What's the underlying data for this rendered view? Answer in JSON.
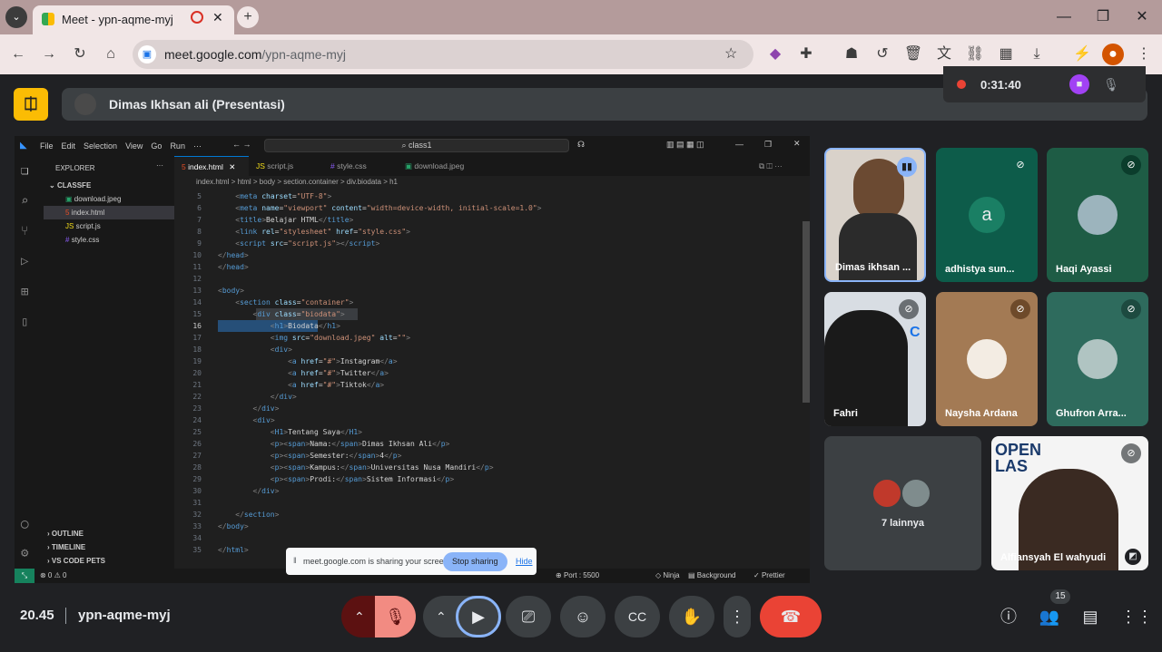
{
  "browser": {
    "tab_title": "Meet - ypn-aqme-myj",
    "url_host": "meet.google.com",
    "url_path": "/ypn-aqme-myj"
  },
  "meet": {
    "presenter_label": "Dimas Ikhsan ali (Presentasi)",
    "recording_time": "0:31:40",
    "clock": "20.45",
    "meeting_code": "ypn-aqme-myj",
    "participants_count": "15",
    "more_label": "7 lainnya",
    "share_notice": "meet.google.com is sharing your screen.",
    "stop_sharing": "Stop sharing",
    "hide": "Hide"
  },
  "participants": [
    {
      "name": "Dimas ikhsan ..."
    },
    {
      "name": "adhistya sun...",
      "initial": "a"
    },
    {
      "name": "Haqi Ayassi"
    },
    {
      "name": "Fahri"
    },
    {
      "name": "Naysha Ardana"
    },
    {
      "name": "Ghufron Arra..."
    },
    {
      "name": "Alfiansyah El wahyudi"
    }
  ],
  "vscode": {
    "menu": [
      "File",
      "Edit",
      "Selection",
      "View",
      "Go",
      "Run",
      "···"
    ],
    "search": "class1",
    "explorer_title": "EXPLORER",
    "folder": "CLASSFE",
    "files": [
      "download.jpeg",
      "index.html",
      "script.js",
      "style.css"
    ],
    "tabs": [
      "index.html",
      "script.js",
      "style.css",
      "download.jpeg"
    ],
    "breadcrumb": "index.html > html > body > section.container > div.biodata > h1",
    "outline": [
      "OUTLINE",
      "TIMELINE",
      "VS CODE PETS"
    ],
    "status_left": "⊗ 0 ⚠ 0",
    "status_right": [
      "Port : 5500",
      "Ninja",
      "Background",
      "Prettier"
    ],
    "code_lines": [
      {
        "n": "5",
        "html": "    <span class='p'>&lt;</span><span class='t'>meta</span> <span class='a'>charset</span>=<span class='s'>\"UTF-8\"</span><span class='p'>&gt;</span>"
      },
      {
        "n": "6",
        "html": "    <span class='p'>&lt;</span><span class='t'>meta</span> <span class='a'>name</span>=<span class='s'>\"viewport\"</span> <span class='a'>content</span>=<span class='s'>\"width=device-width, initial-scale=1.0\"</span><span class='p'>&gt;</span>"
      },
      {
        "n": "7",
        "html": "    <span class='p'>&lt;</span><span class='t'>title</span><span class='p'>&gt;</span>Belajar HTML<span class='p'>&lt;/</span><span class='t'>title</span><span class='p'>&gt;</span>"
      },
      {
        "n": "8",
        "html": "    <span class='p'>&lt;</span><span class='t'>link</span> <span class='a'>rel</span>=<span class='s'>\"stylesheet\"</span> <span class='a'>href</span>=<span class='s'>\"style.css\"</span><span class='p'>&gt;</span>"
      },
      {
        "n": "9",
        "html": "    <span class='p'>&lt;</span><span class='t'>script</span> <span class='a'>src</span>=<span class='s'>\"script.js\"</span><span class='p'>&gt;&lt;/</span><span class='t'>script</span><span class='p'>&gt;</span>"
      },
      {
        "n": "10",
        "html": "<span class='p'>&lt;/</span><span class='t'>head</span><span class='p'>&gt;</span>"
      },
      {
        "n": "11",
        "html": "<span class='p'>&lt;/</span><span class='t'>head</span><span class='p'>&gt;</span>"
      },
      {
        "n": "12",
        "html": ""
      },
      {
        "n": "13",
        "html": "<span class='p'>&lt;</span><span class='t'>body</span><span class='p'>&gt;</span>"
      },
      {
        "n": "14",
        "html": "    <span class='p'>&lt;</span><span class='t'>section</span> <span class='a'>class</span>=<span class='s'>\"container\"</span><span class='p'>&gt;</span>"
      },
      {
        "n": "15",
        "html": "        <span class='p'>&lt;</span><span class='t'>div</span> <span class='a'>class</span>=<span class='s'>\"biodata\"</span><span class='p'>&gt;</span>"
      },
      {
        "n": "16",
        "html": "            <span class='p'>&lt;</span><span class='t'>h1</span><span class='p'>&gt;</span>Biodata<span class='p'>&lt;/</span><span class='t'>h1</span><span class='p'>&gt;</span>"
      },
      {
        "n": "17",
        "html": "            <span class='p'>&lt;</span><span class='t'>img</span> <span class='a'>src</span>=<span class='s'>\"download.jpeg\"</span> <span class='a'>alt</span>=<span class='s'>\"\"</span><span class='p'>&gt;</span>"
      },
      {
        "n": "18",
        "html": "            <span class='p'>&lt;</span><span class='t'>div</span><span class='p'>&gt;</span>"
      },
      {
        "n": "19",
        "html": "                <span class='p'>&lt;</span><span class='t'>a</span> <span class='a'>href</span>=<span class='s'>\"#\"</span><span class='p'>&gt;</span>Instagram<span class='p'>&lt;/</span><span class='t'>a</span><span class='p'>&gt;</span>"
      },
      {
        "n": "20",
        "html": "                <span class='p'>&lt;</span><span class='t'>a</span> <span class='a'>href</span>=<span class='s'>\"#\"</span><span class='p'>&gt;</span>Twitter<span class='p'>&lt;/</span><span class='t'>a</span><span class='p'>&gt;</span>"
      },
      {
        "n": "21",
        "html": "                <span class='p'>&lt;</span><span class='t'>a</span> <span class='a'>href</span>=<span class='s'>\"#\"</span><span class='p'>&gt;</span>Tiktok<span class='p'>&lt;/</span><span class='t'>a</span><span class='p'>&gt;</span>"
      },
      {
        "n": "22",
        "html": "            <span class='p'>&lt;/</span><span class='t'>div</span><span class='p'>&gt;</span>"
      },
      {
        "n": "23",
        "html": "        <span class='p'>&lt;/</span><span class='t'>div</span><span class='p'>&gt;</span>"
      },
      {
        "n": "24",
        "html": "        <span class='p'>&lt;</span><span class='t'>div</span><span class='p'>&gt;</span>"
      },
      {
        "n": "25",
        "html": "            <span class='p'>&lt;</span><span class='t'>H1</span><span class='p'>&gt;</span>Tentang Saya<span class='p'>&lt;/</span><span class='t'>H1</span><span class='p'>&gt;</span>"
      },
      {
        "n": "26",
        "html": "            <span class='p'>&lt;</span><span class='t'>p</span><span class='p'>&gt;&lt;</span><span class='t'>span</span><span class='p'>&gt;</span>Nama:<span class='p'>&lt;/</span><span class='t'>span</span><span class='p'>&gt;</span>Dimas Ikhsan Ali<span class='p'>&lt;/</span><span class='t'>p</span><span class='p'>&gt;</span>"
      },
      {
        "n": "27",
        "html": "            <span class='p'>&lt;</span><span class='t'>p</span><span class='p'>&gt;&lt;</span><span class='t'>span</span><span class='p'>&gt;</span>Semester:<span class='p'>&lt;/</span><span class='t'>span</span><span class='p'>&gt;</span>4<span class='p'>&lt;/</span><span class='t'>p</span><span class='p'>&gt;</span>"
      },
      {
        "n": "28",
        "html": "            <span class='p'>&lt;</span><span class='t'>p</span><span class='p'>&gt;&lt;</span><span class='t'>span</span><span class='p'>&gt;</span>Kampus:<span class='p'>&lt;/</span><span class='t'>span</span><span class='p'>&gt;</span>Universitas Nusa Mandiri<span class='p'>&lt;/</span><span class='t'>p</span><span class='p'>&gt;</span>"
      },
      {
        "n": "29",
        "html": "            <span class='p'>&lt;</span><span class='t'>p</span><span class='p'>&gt;&lt;</span><span class='t'>span</span><span class='p'>&gt;</span>Prodi:<span class='p'>&lt;/</span><span class='t'>span</span><span class='p'>&gt;</span>Sistem Informasi<span class='p'>&lt;/</span><span class='t'>p</span><span class='p'>&gt;</span>"
      },
      {
        "n": "30",
        "html": "        <span class='p'>&lt;/</span><span class='t'>div</span><span class='p'>&gt;</span>"
      },
      {
        "n": "31",
        "html": ""
      },
      {
        "n": "32",
        "html": "    <span class='p'>&lt;/</span><span class='t'>section</span><span class='p'>&gt;</span>"
      },
      {
        "n": "33",
        "html": "<span class='p'>&lt;/</span><span class='t'>body</span><span class='p'>&gt;</span>"
      },
      {
        "n": "34",
        "html": ""
      },
      {
        "n": "35",
        "html": "<span class='p'>&lt;/</span><span class='t'>html</span><span class='p'>&gt;</span>"
      }
    ]
  },
  "colors": {
    "accent_blue": "#8ab4f8",
    "end_call_red": "#ea4335",
    "mute_red": "#f28b82",
    "logo_yellow": "#fbbc04"
  }
}
